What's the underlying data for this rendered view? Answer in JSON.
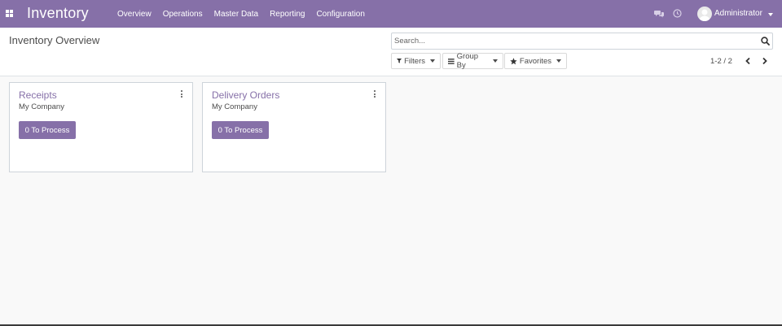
{
  "navbar": {
    "brand": "Inventory",
    "menu": [
      "Overview",
      "Operations",
      "Master Data",
      "Reporting",
      "Configuration"
    ],
    "user_name": "Administrator",
    "icons": {
      "apps": "apps-grid-icon",
      "chat": "chat-icon",
      "activity": "clock-icon"
    },
    "color": "#8670a8"
  },
  "control_panel": {
    "title": "Inventory Overview",
    "search_placeholder": "Search...",
    "filters_label": "Filters",
    "groupby_label": "Group By",
    "favorites_label": "Favorites",
    "pager": "1-2 / 2"
  },
  "cards": [
    {
      "title": "Receipts",
      "company": "My Company",
      "button": "0 To Process"
    },
    {
      "title": "Delivery Orders",
      "company": "My Company",
      "button": "0 To Process"
    }
  ],
  "colors": {
    "accent": "#8670a8",
    "background": "#f9f9f9",
    "text": "#4c4c4c"
  }
}
